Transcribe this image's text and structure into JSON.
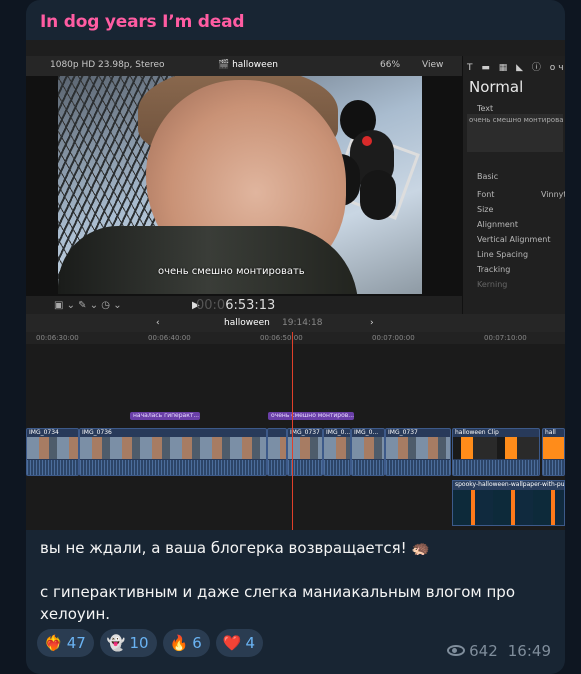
{
  "channel": {
    "title": "In dog years I’m dead"
  },
  "editor": {
    "viewer_format": "1080p HD 23.98p, Stereo",
    "project_name": "halloween",
    "zoom": "66%",
    "view_menu": "View",
    "subtitle_text": "очень смешно монтировать",
    "timecode_dim": "00:0",
    "timecode": "6:53:13",
    "inspector": {
      "title": "Normal",
      "text_label": "Text",
      "text_value": "очень смешно монтировать",
      "basic_label": "Basic",
      "font_label": "Font",
      "font_value": "Vinnyt",
      "size_label": "Size",
      "alignment_label": "Alignment",
      "vertical_alignment_label": "Vertical Alignment",
      "line_spacing_label": "Line Spacing",
      "tracking_label": "Tracking",
      "kerning_label": "Kerning",
      "top_label": "очень"
    },
    "timeline": {
      "project": "halloween",
      "duration": "19:14:18",
      "ruler": [
        "00:06:30:00",
        "00:06:40:00",
        "00:06:50:00",
        "00:07:00:00",
        "00:07:10:00"
      ],
      "titles": [
        "началась гиперакт...",
        "очень смешно монтиров..."
      ],
      "clips": [
        "IMG_0734",
        "IMG_0736",
        "",
        "IMG_0737",
        "IMG_0...",
        "IMG_0...",
        "IMG_0737",
        "halloween Clip",
        "hall"
      ],
      "spooky": "spooky-halloween-wallpaper-with-pum"
    }
  },
  "message": {
    "line1": "вы не ждали, а ваша блогерка возвращается! 🦔",
    "line2": "с гиперактивным и даже слегка маниакальным влогом про хелоуин."
  },
  "reactions": [
    {
      "emoji": "❤️‍🔥",
      "count": "47"
    },
    {
      "emoji": "👻",
      "count": "10"
    },
    {
      "emoji": "🔥",
      "count": "6"
    },
    {
      "emoji": "❤️",
      "count": "4"
    }
  ],
  "views": "642",
  "time": "16:49"
}
